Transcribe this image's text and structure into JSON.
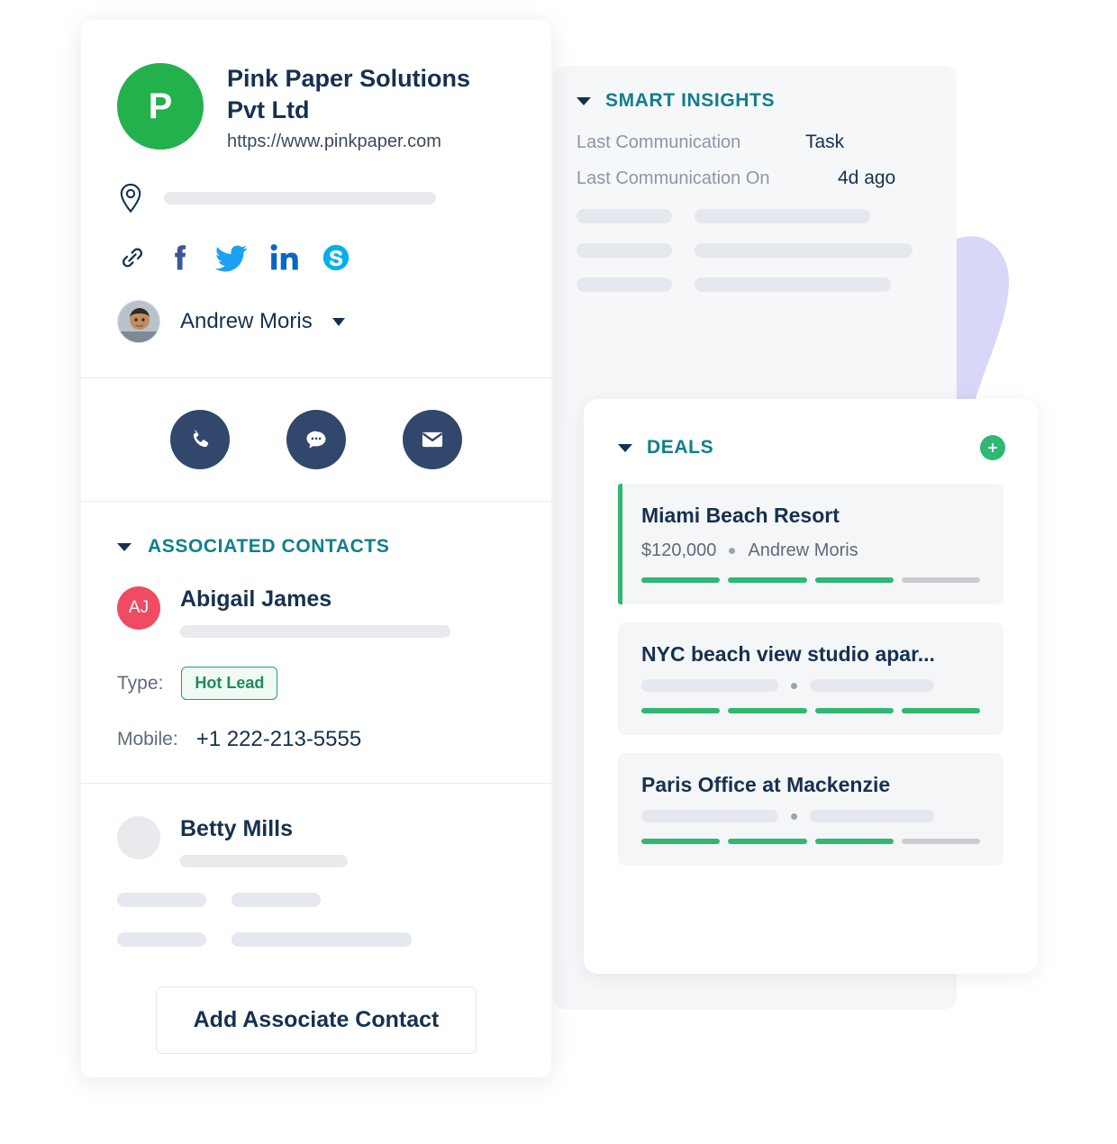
{
  "company": {
    "avatar_initial": "P",
    "avatar_color": "#22b14c",
    "name": "Pink Paper Solutions Pvt Ltd",
    "website": "https://www.pinkpaper.com",
    "location_icon": "map-pin-icon",
    "social_links": [
      {
        "name": "link-icon",
        "color": "#16314f"
      },
      {
        "name": "facebook-icon",
        "color": "#3b5998"
      },
      {
        "name": "twitter-icon",
        "color": "#1da1f2"
      },
      {
        "name": "linkedin-icon",
        "color": "#0a66c2"
      },
      {
        "name": "skype-icon",
        "color": "#00aff0"
      }
    ],
    "owner": "Andrew Moris"
  },
  "actions": [
    {
      "name": "call-button",
      "icon": "phone-icon"
    },
    {
      "name": "message-button",
      "icon": "chat-bubble-icon"
    },
    {
      "name": "email-button",
      "icon": "envelope-icon"
    }
  ],
  "associated_contacts": {
    "title": "ASSOCIATED CONTACTS",
    "contacts": [
      {
        "initials": "AJ",
        "avatar_color": "#ef4b63",
        "name": "Abigail James",
        "type_label": "Type:",
        "type_value": "Hot Lead",
        "mobile_label": "Mobile:",
        "mobile_value": "+1 222-213-5555"
      },
      {
        "initials": "",
        "avatar_color": "#e8eaee",
        "name": "Betty Mills"
      }
    ],
    "add_button_label": "Add Associate Contact"
  },
  "smart_insights": {
    "title": "SMART INSIGHTS",
    "rows": [
      {
        "label": "Last Communication",
        "value": "Task"
      },
      {
        "label": "Last Communication On",
        "value": "4d ago"
      }
    ]
  },
  "deals": {
    "title": "DEALS",
    "add_icon": "plus-icon",
    "accent_color": "#2eb872",
    "items": [
      {
        "title": "Miami Beach Resort",
        "amount": "$120,000",
        "owner": "Andrew Moris",
        "masked": false,
        "accent": true,
        "stages": [
          "done",
          "done",
          "done",
          "todo"
        ]
      },
      {
        "title": "NYC beach view studio apar...",
        "amount": "",
        "owner": "",
        "masked": true,
        "accent": false,
        "stages": [
          "done",
          "done",
          "done",
          "done"
        ]
      },
      {
        "title": "Paris Office at Mackenzie",
        "amount": "",
        "owner": "",
        "masked": true,
        "accent": false,
        "stages": [
          "done",
          "done",
          "done",
          "todo"
        ]
      }
    ]
  },
  "theme": {
    "section_heading_color": "#0f7f8c",
    "text_dark": "#16314f",
    "muted": "#8c97a5",
    "skeleton": "#e8eaee",
    "purple_blob": "#d9d7f7"
  }
}
